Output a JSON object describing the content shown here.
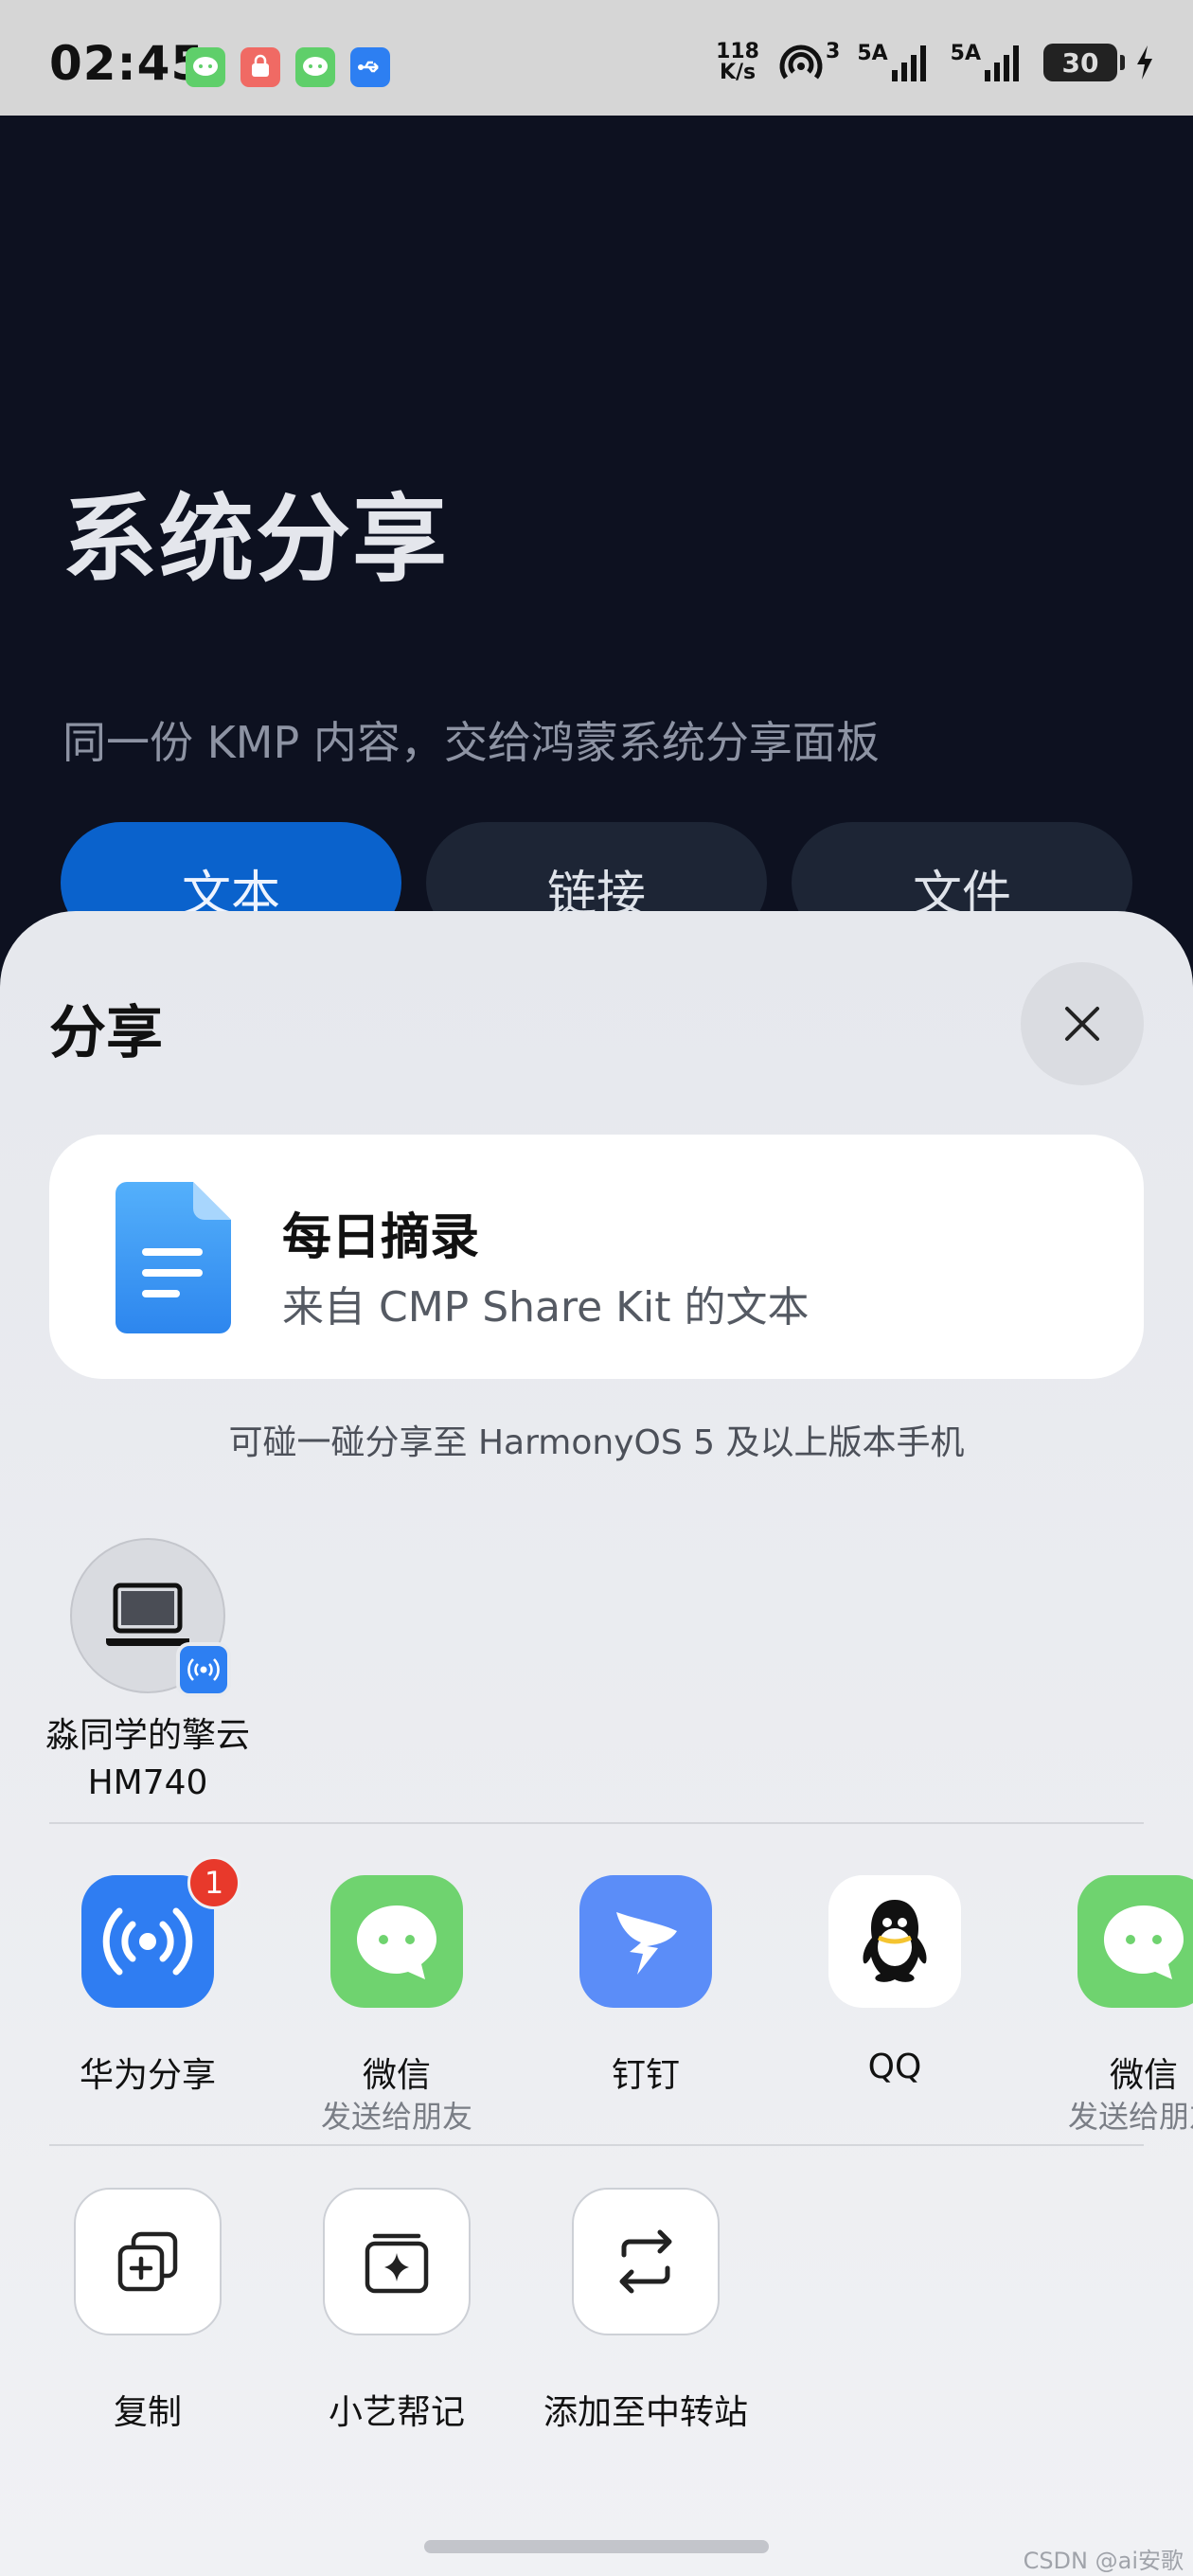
{
  "status_bar": {
    "time": "02:45",
    "net_speed_top": "118",
    "net_speed_bottom": "K/s",
    "hotspot_count": "3",
    "sim1_label": "5A",
    "sim2_label": "5A",
    "battery": "30"
  },
  "background_app": {
    "title": "系统分享",
    "subtitle": "同一份 KMP 内容，交给鸿蒙系统分享面板",
    "tabs": [
      {
        "label": "文本",
        "active": true
      },
      {
        "label": "链接",
        "active": false
      },
      {
        "label": "文件",
        "active": false
      }
    ]
  },
  "share_sheet": {
    "title": "分享",
    "preview": {
      "title": "每日摘录",
      "subtitle": "来自 CMP Share Kit 的文本"
    },
    "nfc_hint": "可碰一碰分享至 HarmonyOS 5 及以上版本手机",
    "device": {
      "name_line1": "淼同学的擎云",
      "name_line2": "HM740"
    },
    "apps": [
      {
        "label": "华为分享",
        "sublabel": "",
        "badge": "1",
        "icon": "huawei-share-icon",
        "color": "#2f7df2"
      },
      {
        "label": "微信",
        "sublabel": "发送给朋友",
        "badge": "",
        "icon": "wechat-icon",
        "color": "#6fd36f"
      },
      {
        "label": "钉钉",
        "sublabel": "",
        "badge": "",
        "icon": "dingtalk-icon",
        "color": "#5b8df8"
      },
      {
        "label": "QQ",
        "sublabel": "",
        "badge": "",
        "icon": "qq-icon",
        "color": "#ffffff"
      },
      {
        "label": "微信",
        "sublabel": "发送给朋友",
        "badge": "",
        "icon": "wechat-icon",
        "color": "#6fd36f"
      }
    ],
    "actions": [
      {
        "label": "复制",
        "icon": "copy-icon"
      },
      {
        "label": "小艺帮记",
        "icon": "xiaoyi-note-icon"
      },
      {
        "label": "添加至中转站",
        "icon": "transfer-station-icon"
      }
    ]
  },
  "watermark": "CSDN @ai安歌"
}
